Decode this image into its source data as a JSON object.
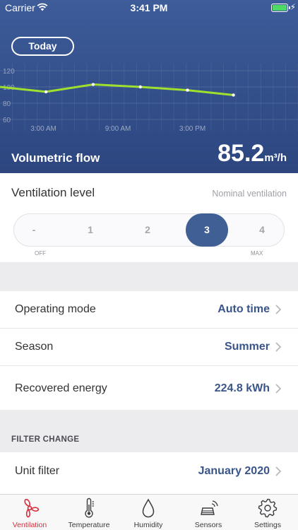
{
  "status_bar": {
    "carrier": "Carrier",
    "time": "3:41 PM",
    "battery_level": 1.0
  },
  "header": {
    "period_button": "Today",
    "flow_label": "Volumetric flow",
    "flow_value": "85.2",
    "flow_unit": "m³/h"
  },
  "chart_data": {
    "type": "line",
    "y_ticks": [
      "120",
      "100",
      "80",
      "60"
    ],
    "ylim": [
      60,
      120
    ],
    "x_ticks": [
      "3:00 AM",
      "9:00 AM",
      "3:00 PM"
    ],
    "x_tick_hours": [
      3,
      9,
      15
    ],
    "xlim": [
      -0.5,
      23.5
    ],
    "x_hours": [
      -0.5,
      3.2,
      7.0,
      10.8,
      14.6,
      18.3
    ],
    "values": [
      100,
      94,
      103,
      100,
      96,
      90
    ],
    "grid": true,
    "line_color": "#9ee02d"
  },
  "ventilation": {
    "title": "Ventilation level",
    "mode": "Nominal ventilation",
    "levels": [
      "-",
      "1",
      "2",
      "3",
      "4"
    ],
    "selected_index": 3,
    "min_caption": "OFF",
    "max_caption": "MAX"
  },
  "settings_rows": [
    {
      "label": "Operating mode",
      "value": "Auto time"
    },
    {
      "label": "Season",
      "value": "Summer"
    },
    {
      "label": "Recovered energy",
      "value": "224.8 kWh"
    }
  ],
  "filter_section": {
    "header": "FILTER CHANGE",
    "rows": [
      {
        "label": "Unit filter",
        "value": "January 2020"
      }
    ]
  },
  "tabs": [
    {
      "label": "Ventilation",
      "icon": "fan-icon",
      "active": true
    },
    {
      "label": "Temperature",
      "icon": "thermometer-icon",
      "active": false
    },
    {
      "label": "Humidity",
      "icon": "droplet-icon",
      "active": false
    },
    {
      "label": "Sensors",
      "icon": "sensor-icon",
      "active": false
    },
    {
      "label": "Settings",
      "icon": "gear-icon",
      "active": false
    }
  ],
  "colors": {
    "accent": "#3a5589",
    "active_tab": "#d62e3d",
    "chart_line": "#9ee02d",
    "header_bg": "#375591"
  }
}
